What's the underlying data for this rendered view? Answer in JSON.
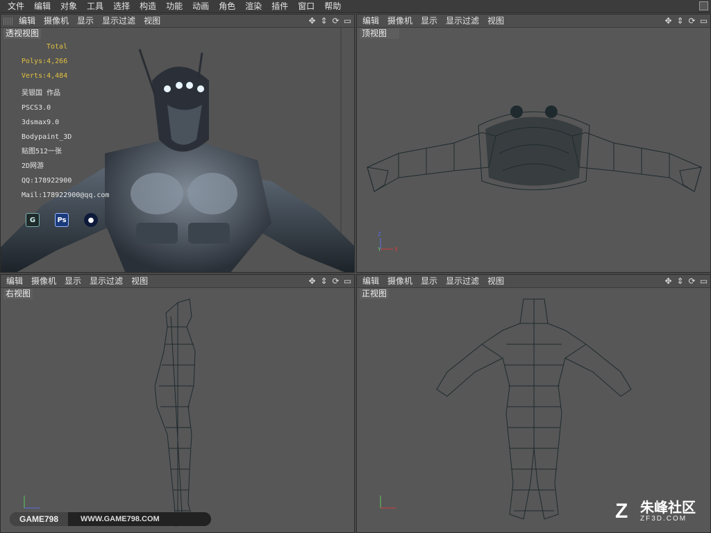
{
  "menubar": {
    "items": [
      "文件",
      "编辑",
      "对象",
      "工具",
      "选择",
      "构造",
      "功能",
      "动画",
      "角色",
      "渲染",
      "插件",
      "窗口",
      "帮助"
    ]
  },
  "viewport_menu": [
    "编辑",
    "摄像机",
    "显示",
    "显示过滤",
    "视图"
  ],
  "viewports": {
    "perspective": {
      "label": "透视视图"
    },
    "top": {
      "label": "顶视图"
    },
    "right": {
      "label": "右视图"
    },
    "front": {
      "label": "正视图"
    }
  },
  "stats": {
    "total": "Total",
    "polys": "Polys:4,266",
    "verts": "Verts:4,484",
    "lines": [
      "吴银国 作品",
      "PSCS3.0",
      "3dsmax9.0",
      "Bodypaint_3D",
      "贴图512一张",
      "2D网游",
      "QQ:178922900",
      "Mail:178922900@qq.com"
    ]
  },
  "axis": {
    "x": "X",
    "y": "Y",
    "z": "Z"
  },
  "watermark": {
    "left": "GAME798",
    "right": "WWW.GAME798.COM"
  },
  "zf_logo": {
    "cn": "朱峰社区",
    "en": "ZF3D.COM"
  },
  "colors": {
    "stats_yellow": "#e0c040",
    "viewport_bg": "#575757",
    "wire": "#1f2a2e",
    "axis_x": "#d23c3c",
    "axis_y": "#5ec85e",
    "axis_z": "#5a6ee6"
  },
  "icons": [
    "move-icon",
    "zoom-icon",
    "rotate-icon",
    "maximize-icon",
    "grip-icon",
    "app-icon-3dsmax",
    "app-icon-photoshop",
    "app-icon-bodypaint"
  ]
}
